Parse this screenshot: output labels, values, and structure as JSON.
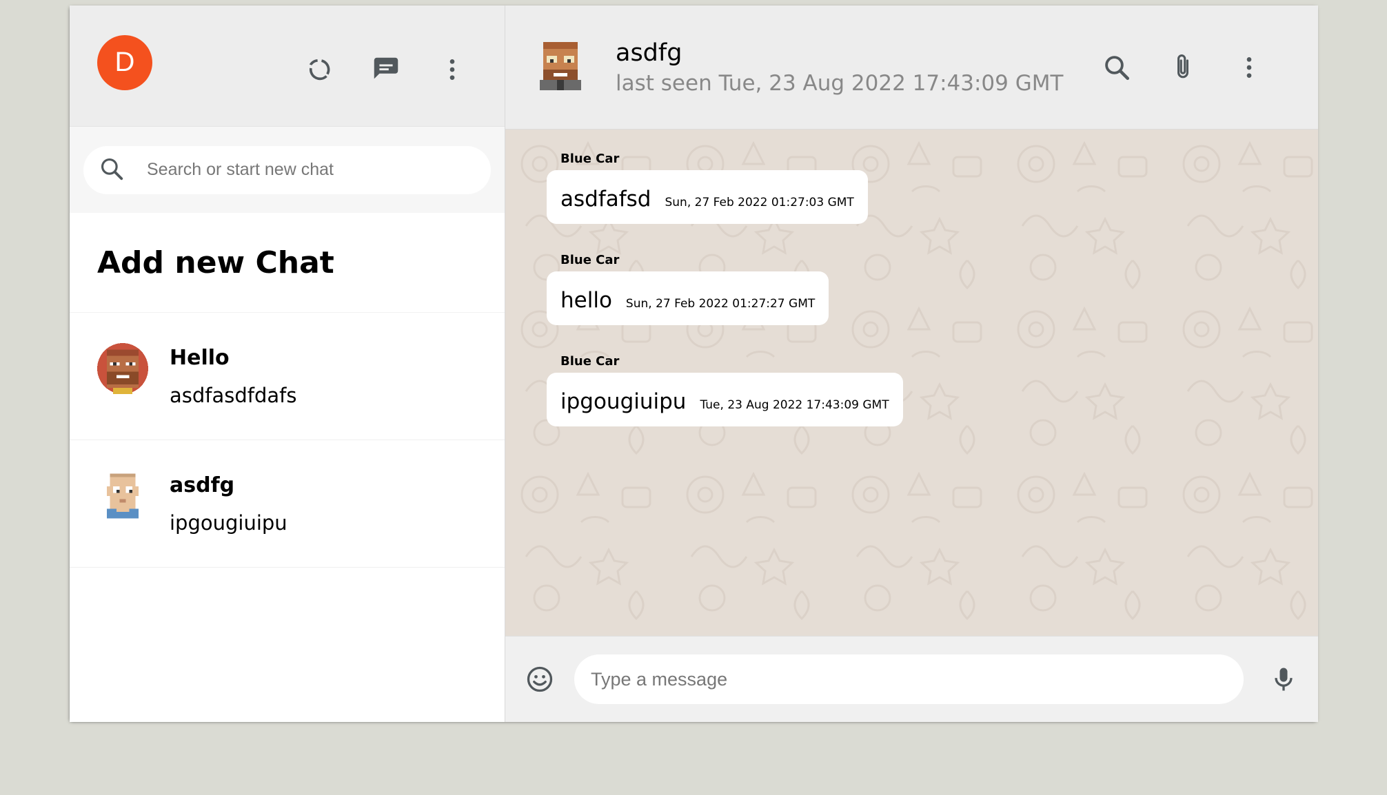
{
  "colors": {
    "page_bg": "#dadbd3",
    "accent_avatar": "#f4511e",
    "chat_bg": "#e5ddd5",
    "header_bg": "#ededed"
  },
  "sidebar": {
    "user_initial": "D",
    "header_icons": [
      "status-icon",
      "chat-icon",
      "more-vert-icon"
    ],
    "search": {
      "placeholder": "Search or start new chat",
      "value": ""
    },
    "add_chat_label": "Add new Chat",
    "chats": [
      {
        "name": "Hello",
        "last_message": "asdfasdfdafs",
        "avatar": "pixel-avatar-bearded"
      },
      {
        "name": "asdfg",
        "last_message": "ipgougiuipu",
        "avatar": "pixel-avatar-bald"
      }
    ]
  },
  "chat": {
    "header": {
      "name": "asdfg",
      "last_seen": "last seen Tue, 23 Aug 2022 17:43:09 GMT",
      "icons": [
        "search-icon",
        "attach-icon",
        "more-vert-icon"
      ]
    },
    "messages": [
      {
        "sender": "Blue Car",
        "text": "asdfafsd",
        "time": "Sun, 27 Feb 2022 01:27:03 GMT"
      },
      {
        "sender": "Blue Car",
        "text": "hello",
        "time": "Sun, 27 Feb 2022 01:27:27 GMT"
      },
      {
        "sender": "Blue Car",
        "text": "ipgougiuipu",
        "time": "Tue, 23 Aug 2022 17:43:09 GMT"
      }
    ],
    "footer": {
      "placeholder": "Type a message",
      "value": "",
      "icons": [
        "emoji-icon",
        "mic-icon"
      ]
    }
  }
}
